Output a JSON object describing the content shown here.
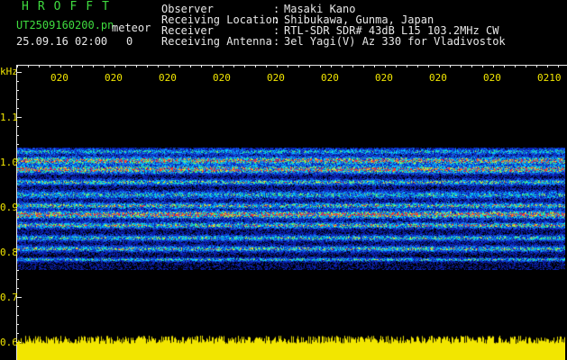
{
  "header": {
    "app_title": "HROFFT",
    "filename": "UT2509160200.pn",
    "mode": "meteor",
    "datetime": "25.09.16 02:00",
    "counter": "0",
    "rows": [
      {
        "label": "Observer",
        "colon": ":",
        "value": "Masaki Kano"
      },
      {
        "label": "Receiving Location",
        "colon": ":",
        "value": "Shibukawa, Gunma, Japan"
      },
      {
        "label": "Receiver",
        "colon": ":",
        "value": "RTL-SDR SDR# 43dB L15 103.2MHz CW"
      },
      {
        "label": "Receiving Antenna",
        "colon": ":",
        "value": "3el Yagi(V) Az 330 for Vladivostok"
      }
    ]
  },
  "plot": {
    "y_unit": "kHz",
    "y_ticks": [
      "1.1",
      "1.0",
      "0.9",
      "0.8",
      "0.7",
      "0.6"
    ],
    "x_ticks": [
      "020",
      "020",
      "020",
      "020",
      "020",
      "020",
      "020",
      "020",
      "020",
      "0210"
    ],
    "colors": {
      "background": "#000000",
      "frame": "#e8e8e8",
      "label": "#f2e600",
      "title_green": "#3fdc3f",
      "noise_low": "#0a1aa8",
      "noise_mid": "#00b4ff",
      "noise_high": "#ff2a2a",
      "signal_strip": "#f2e600"
    }
  }
}
